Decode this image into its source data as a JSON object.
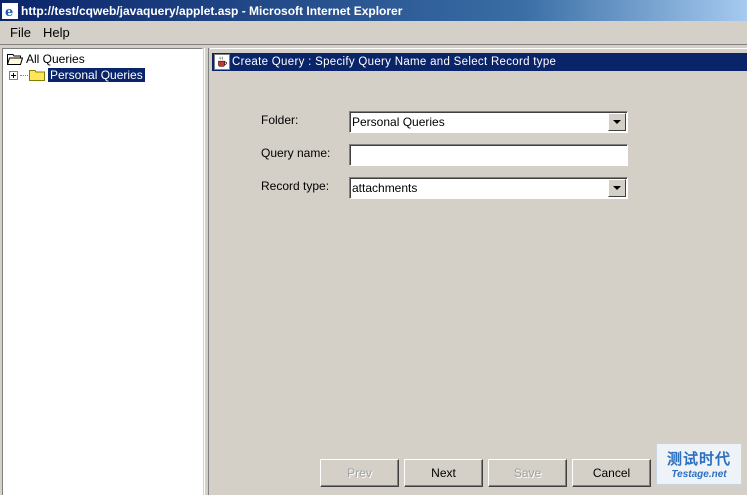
{
  "window": {
    "title": "http://test/cqweb/javaquery/applet.asp - Microsoft Internet Explorer"
  },
  "menu": {
    "items": [
      "File",
      "Help"
    ]
  },
  "tree": {
    "root_label": "All Queries",
    "child_label": "Personal Queries"
  },
  "panel": {
    "header": "Create Query :  Specify Query Name and Select Record type"
  },
  "form": {
    "folder_label": "Folder:",
    "folder_value": "Personal Queries",
    "query_name_label": "Query name:",
    "query_name_value": "",
    "record_type_label": "Record type:",
    "record_type_value": "attachments"
  },
  "buttons": {
    "prev": "Prev",
    "next": "Next",
    "save": "Save",
    "cancel": "Cancel"
  },
  "watermark": {
    "top": "测试时代",
    "bottom": "Testage.net"
  },
  "colors": {
    "titlebar": "#0a246a",
    "selection": "#0a246a",
    "panel_bg": "#d4d0c8"
  }
}
